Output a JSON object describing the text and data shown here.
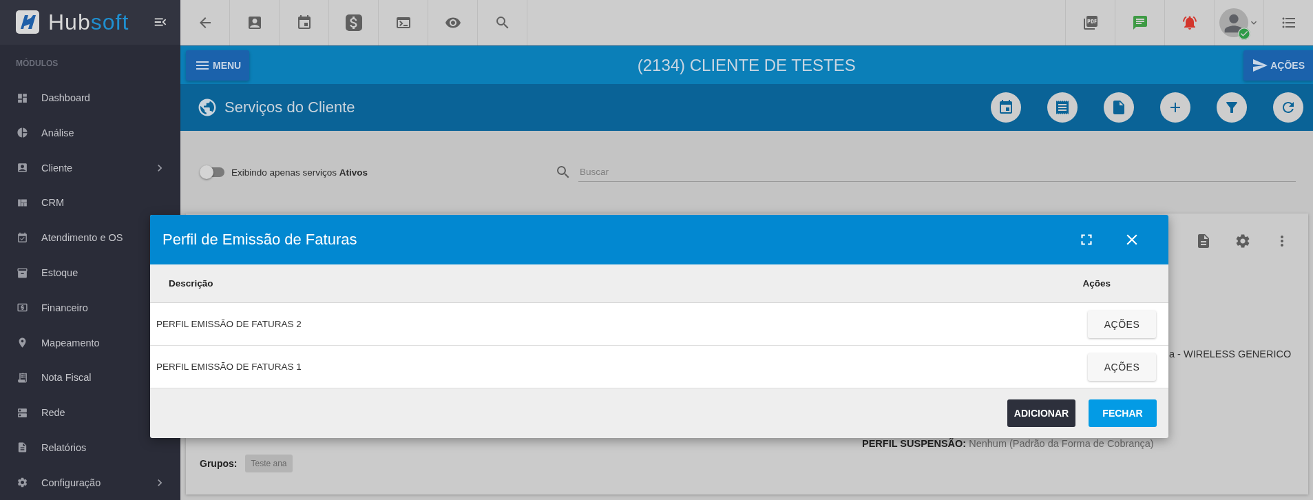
{
  "sidebar": {
    "brand": [
      "Hub",
      "soft"
    ],
    "section_label": "MÓDULOS",
    "items": [
      {
        "label": "Dashboard",
        "kind": "dashboard",
        "expandable": false
      },
      {
        "label": "Análise",
        "kind": "analysis",
        "expandable": false
      },
      {
        "label": "Cliente",
        "kind": "client",
        "expandable": true
      },
      {
        "label": "CRM",
        "kind": "crm",
        "expandable": false
      },
      {
        "label": "Atendimento e OS",
        "kind": "service",
        "expandable": false
      },
      {
        "label": "Estoque",
        "kind": "stock",
        "expandable": false
      },
      {
        "label": "Financeiro",
        "kind": "finance",
        "expandable": false
      },
      {
        "label": "Mapeamento",
        "kind": "map",
        "expandable": false
      },
      {
        "label": "Nota Fiscal",
        "kind": "invoice",
        "expandable": false
      },
      {
        "label": "Rede",
        "kind": "network",
        "expandable": false
      },
      {
        "label": "Relatórios",
        "kind": "reports",
        "expandable": false
      },
      {
        "label": "Configuração",
        "kind": "settings",
        "expandable": true
      }
    ]
  },
  "header": {
    "menu_button": "MENU",
    "title": "(2134) CLIENTE DE TESTES",
    "actions_button": "AÇÕES"
  },
  "section": {
    "title": "Serviços do Cliente"
  },
  "filter": {
    "toggle": {
      "label": "Exibindo apenas serviços **Ativos**",
      "on": false
    },
    "search": {
      "placeholder": "Buscar"
    }
  },
  "card": {
    "partial_text": "a - WIRELESS GENERICO",
    "perfil": {
      "label": "PERFIL SUSPENSÃO:",
      "value": "Nenhum (Padrão da Forma de Cobrança)"
    },
    "groups": {
      "label": "Grupos:",
      "tags": [
        "Teste ana"
      ]
    }
  },
  "modal": {
    "title": "Perfil de Emissão de Faturas",
    "columns": [
      "Descrição",
      "Ações"
    ],
    "rows": [
      {
        "description": "PERFIL EMISSÃO DE FATURAS 2",
        "action": "AÇÕES"
      },
      {
        "description": "PERFIL EMISSÃO DE FATURAS 1",
        "action": "AÇÕES"
      }
    ],
    "buttons": [
      {
        "label": "ADICIONAR",
        "kind": "secondary"
      },
      {
        "label": "FECHAR",
        "kind": "primary"
      }
    ]
  }
}
